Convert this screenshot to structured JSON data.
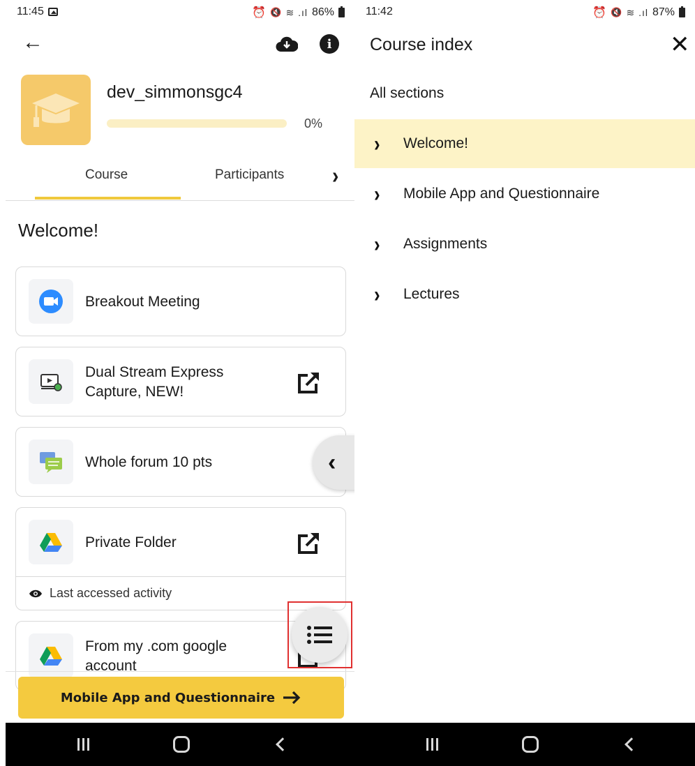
{
  "left": {
    "status": {
      "time": "11:45",
      "battery": "86%"
    },
    "course": {
      "name": "dev_simmonsgc4",
      "progress_percent": 0,
      "progress_label": "0%"
    },
    "tabs": [
      "Course",
      "Participants"
    ],
    "section_title": "Welcome!",
    "activities": [
      {
        "label": "Breakout Meeting",
        "icon": "zoom-video-icon",
        "external": false
      },
      {
        "label_line1": "Dual Stream Express",
        "label_line2": "Capture, NEW!",
        "icon": "video-capture-icon",
        "external": true
      },
      {
        "label": "Whole forum 10 pts",
        "icon": "forum-icon",
        "external": false
      },
      {
        "label": "Private Folder",
        "icon": "google-drive-icon",
        "external": true,
        "footer": "Last accessed activity"
      },
      {
        "label_line1": "From my .com google",
        "label_line2": "account",
        "icon": "google-drive-icon",
        "external": true
      }
    ],
    "next_button": "Mobile App and Questionnaire"
  },
  "right": {
    "status": {
      "time": "11:42",
      "battery": "87%"
    },
    "title": "Course index",
    "all_sections": "All sections",
    "sections": [
      {
        "label": "Welcome!",
        "active": true
      },
      {
        "label": "Mobile App and Questionnaire",
        "active": false
      },
      {
        "label": "Assignments",
        "active": false
      },
      {
        "label": "Lectures",
        "active": false
      }
    ]
  },
  "colors": {
    "accent": "#f4ca3f",
    "highlight": "#fdf3c7",
    "course_image": "#f5c96a",
    "annotation_box": "#e03030"
  }
}
